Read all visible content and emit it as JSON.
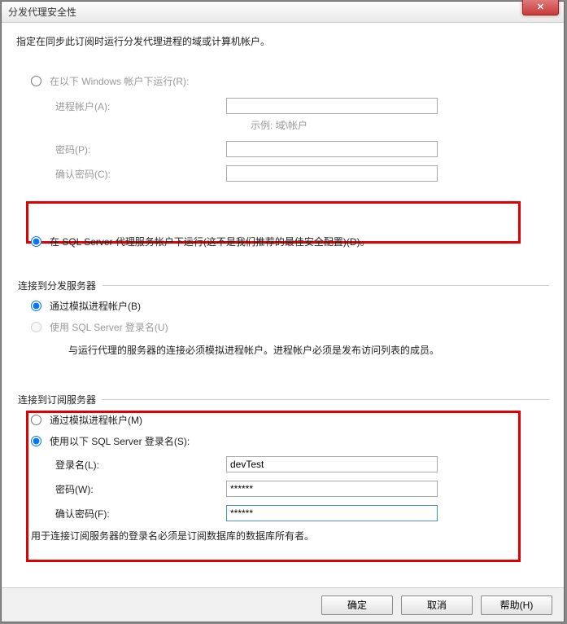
{
  "title": "分发代理安全性",
  "instruction": "指定在同步此订阅时运行分发代理进程的域或计算机帐户。",
  "runAs": {
    "windows": {
      "label": "在以下 Windows 帐户下运行(R):",
      "selected": false,
      "processAccount": {
        "label": "进程帐户(A):",
        "value": "",
        "hint": "示例: 域\\帐户"
      },
      "password": {
        "label": "密码(P):",
        "value": ""
      },
      "confirm": {
        "label": "确认密码(C):",
        "value": ""
      }
    },
    "sqlAgent": {
      "label": "在 SQL Server 代理服务帐户下运行(这不是我们推荐的最佳安全配置)(D)。",
      "selected": true
    }
  },
  "distServer": {
    "header": "连接到分发服务器",
    "impersonate": {
      "label": "通过模拟进程帐户(B)",
      "selected": true
    },
    "sqlLogin": {
      "label": "使用 SQL Server 登录名(U)",
      "selected": false,
      "disabled": true
    },
    "note": "与运行代理的服务器的连接必须模拟进程帐户。进程帐户必须是发布访问列表的成员。"
  },
  "subServer": {
    "header": "连接到订阅服务器",
    "impersonate": {
      "label": "通过模拟进程帐户(M)",
      "selected": false
    },
    "sqlLogin": {
      "label": "使用以下 SQL Server 登录名(S):",
      "selected": true
    },
    "login": {
      "label": "登录名(L):",
      "value": "devTest"
    },
    "password": {
      "label": "密码(W):",
      "value": "******"
    },
    "confirm": {
      "label": "确认密码(F):",
      "value": "******"
    },
    "note": "用于连接订阅服务器的登录名必须是订阅数据库的数据库所有者。"
  },
  "buttons": {
    "ok": "确定",
    "cancel": "取消",
    "help": "帮助(H)"
  }
}
